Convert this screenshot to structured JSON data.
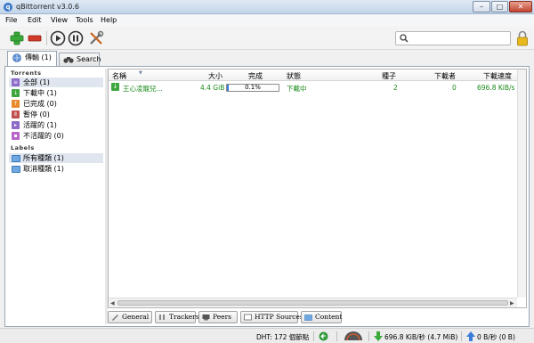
{
  "window": {
    "title": "qBittorrent v3.0.6",
    "app_icon": "qb-logo-icon",
    "controls": [
      "minimize-icon",
      "maximize-icon",
      "close-icon"
    ]
  },
  "menu": [
    "File",
    "Edit",
    "View",
    "Tools",
    "Help"
  ],
  "toolbar": {
    "buttons": [
      "add-torrent-icon",
      "delete-icon",
      "resume-icon",
      "pause-icon",
      "options-icon"
    ],
    "search_placeholder": "",
    "lock_icon": "lock-icon"
  },
  "main_tabs": [
    {
      "label": "傳輸 (1)",
      "icon": "transfer-globe-icon",
      "active": true
    },
    {
      "label": "Search",
      "icon": "binoculars-icon",
      "active": false
    }
  ],
  "sidebar": {
    "torrents_header": "Torrents",
    "status_filters": [
      {
        "label": "全部 (1)",
        "icon": "all-icon",
        "color": "#8e6bc9",
        "selected": true
      },
      {
        "label": "下載中 (1)",
        "icon": "downloading-icon",
        "color": "#3ea63e"
      },
      {
        "label": "已完成 (0)",
        "icon": "completed-icon",
        "color": "#e98b2a"
      },
      {
        "label": "暫停 (0)",
        "icon": "paused-icon",
        "color": "#c0504d"
      },
      {
        "label": "活躍的 (1)",
        "icon": "active-icon",
        "color": "#8e6bc9"
      },
      {
        "label": "不活躍的 (0)",
        "icon": "inactive-icon",
        "color": "#b864c8"
      }
    ],
    "labels_header": "Labels",
    "label_filters": [
      {
        "label": "所有種類 (1)",
        "icon": "folder-icon",
        "selected": true
      },
      {
        "label": "取消種類 (1)",
        "icon": "folder-icon"
      }
    ]
  },
  "transfer_list": {
    "columns": [
      "名稱",
      "大小",
      "完成",
      "狀態",
      "種子",
      "下載者",
      "下載速度"
    ],
    "rows": [
      {
        "name": "王心凌寵兒...",
        "size": "4.4 GiB",
        "progress": 0.001,
        "progress_text": "0.1%",
        "status": "下載中",
        "seeds": "2",
        "peers": "0",
        "down_speed": "696.8 KiB/s"
      }
    ]
  },
  "bottom_tabs": [
    {
      "label": "General",
      "icon": "general-icon"
    },
    {
      "label": "Trackers",
      "icon": "trackers-icon"
    },
    {
      "label": "Peers",
      "icon": "peers-icon"
    },
    {
      "label": "HTTP Sources",
      "icon": "http-sources-icon"
    },
    {
      "label": "Content",
      "icon": "content-folder-icon"
    }
  ],
  "statusbar": {
    "dht": "DHT: 172 個節點",
    "connection_icon": "connection-ok-icon",
    "speed_limit_icon": "speed-limit-icon",
    "download": "696.8 KiB/秒 (4.7 MiB)",
    "upload": "0 B/秒 (0 B)"
  },
  "colors": {
    "downloading_text": "#1a8a1a",
    "progress_fill": "#3a7bd5",
    "selection": "#dfe6ef"
  }
}
